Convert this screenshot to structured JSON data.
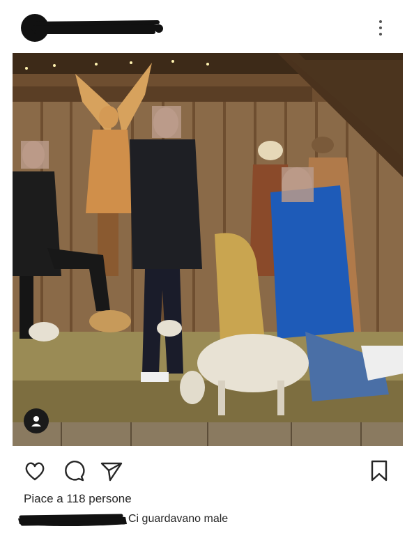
{
  "post": {
    "likes_text": "Piace a 118 persone",
    "caption": "Ci guardavano male"
  },
  "icons": {
    "more": "more-vertical-icon",
    "like": "heart-icon",
    "comment": "comment-bubble-icon",
    "share": "paper-plane-icon",
    "save": "bookmark-icon",
    "tags": "user-tag-icon"
  },
  "colors": {
    "text": "#262626",
    "icon": "#262626",
    "redaction": "#111111"
  }
}
